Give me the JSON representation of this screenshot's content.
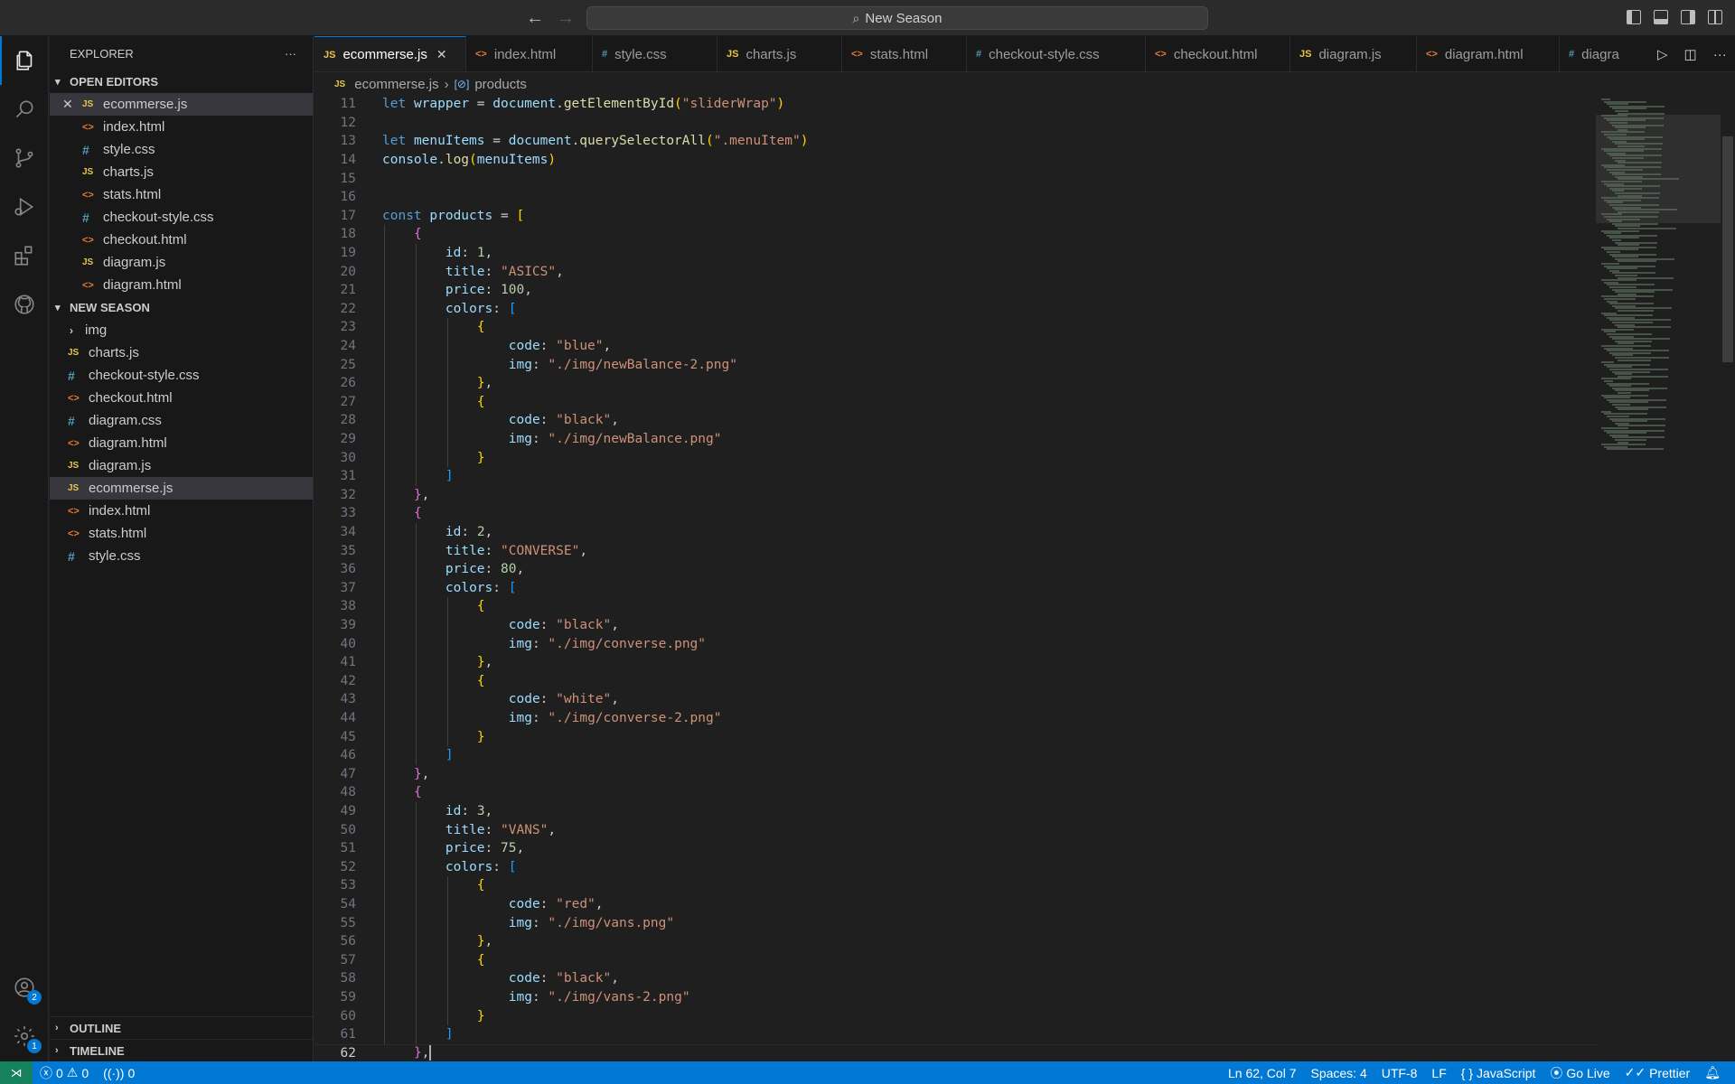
{
  "titlebar": {
    "search_text": "New Season"
  },
  "activity": {
    "accounts_badge": "2",
    "settings_badge": "1"
  },
  "explorer": {
    "title": "EXPLORER",
    "more": "···",
    "open_editors_title": "OPEN EDITORS",
    "open_editors": [
      {
        "name": "ecommerse.js",
        "type": "js"
      },
      {
        "name": "index.html",
        "type": "html"
      },
      {
        "name": "style.css",
        "type": "css"
      },
      {
        "name": "charts.js",
        "type": "js"
      },
      {
        "name": "stats.html",
        "type": "html"
      },
      {
        "name": "checkout-style.css",
        "type": "css"
      },
      {
        "name": "checkout.html",
        "type": "html"
      },
      {
        "name": "diagram.js",
        "type": "js"
      },
      {
        "name": "diagram.html",
        "type": "html"
      }
    ],
    "folder_title": "NEW SEASON",
    "folder_items": [
      {
        "name": "img",
        "type": "folder"
      },
      {
        "name": "charts.js",
        "type": "js"
      },
      {
        "name": "checkout-style.css",
        "type": "css"
      },
      {
        "name": "checkout.html",
        "type": "html"
      },
      {
        "name": "diagram.css",
        "type": "css"
      },
      {
        "name": "diagram.html",
        "type": "html"
      },
      {
        "name": "diagram.js",
        "type": "js"
      },
      {
        "name": "ecommerse.js",
        "type": "js"
      },
      {
        "name": "index.html",
        "type": "html"
      },
      {
        "name": "stats.html",
        "type": "html"
      },
      {
        "name": "style.css",
        "type": "css"
      }
    ],
    "outline_title": "OUTLINE",
    "timeline_title": "TIMELINE"
  },
  "tabs": [
    {
      "label": "ecommerse.js",
      "type": "js",
      "active": true
    },
    {
      "label": "index.html",
      "type": "html"
    },
    {
      "label": "style.css",
      "type": "css"
    },
    {
      "label": "charts.js",
      "type": "js"
    },
    {
      "label": "stats.html",
      "type": "html"
    },
    {
      "label": "checkout-style.css",
      "type": "css"
    },
    {
      "label": "checkout.html",
      "type": "html"
    },
    {
      "label": "diagram.js",
      "type": "js"
    },
    {
      "label": "diagram.html",
      "type": "html"
    },
    {
      "label": "diagra",
      "type": "css"
    }
  ],
  "breadcrumb": {
    "file": "ecommerse.js",
    "symbol": "products"
  },
  "code": [
    {
      "n": "11",
      "t": "let wrapper = document.getElementById(\"sliderWrap\")"
    },
    {
      "n": "12",
      "t": ""
    },
    {
      "n": "13",
      "t": "let menuItems = document.querySelectorAll(\".menuItem\")"
    },
    {
      "n": "14",
      "t": "console.log(menuItems)"
    },
    {
      "n": "15",
      "t": ""
    },
    {
      "n": "16",
      "t": ""
    },
    {
      "n": "17",
      "t": "const products = ["
    },
    {
      "n": "18",
      "t": "    {"
    },
    {
      "n": "19",
      "t": "        id: 1,"
    },
    {
      "n": "20",
      "t": "        title: \"ASICS\","
    },
    {
      "n": "21",
      "t": "        price: 100,"
    },
    {
      "n": "22",
      "t": "        colors: ["
    },
    {
      "n": "23",
      "t": "            {"
    },
    {
      "n": "24",
      "t": "                code: \"blue\","
    },
    {
      "n": "25",
      "t": "                img: \"./img/newBalance-2.png\""
    },
    {
      "n": "26",
      "t": "            },"
    },
    {
      "n": "27",
      "t": "            {"
    },
    {
      "n": "28",
      "t": "                code: \"black\","
    },
    {
      "n": "29",
      "t": "                img: \"./img/newBalance.png\""
    },
    {
      "n": "30",
      "t": "            }"
    },
    {
      "n": "31",
      "t": "        ]"
    },
    {
      "n": "32",
      "t": "    },"
    },
    {
      "n": "33",
      "t": "    {"
    },
    {
      "n": "34",
      "t": "        id: 2,"
    },
    {
      "n": "35",
      "t": "        title: \"CONVERSE\","
    },
    {
      "n": "36",
      "t": "        price: 80,"
    },
    {
      "n": "37",
      "t": "        colors: ["
    },
    {
      "n": "38",
      "t": "            {"
    },
    {
      "n": "39",
      "t": "                code: \"black\","
    },
    {
      "n": "40",
      "t": "                img: \"./img/converse.png\""
    },
    {
      "n": "41",
      "t": "            },"
    },
    {
      "n": "42",
      "t": "            {"
    },
    {
      "n": "43",
      "t": "                code: \"white\","
    },
    {
      "n": "44",
      "t": "                img: \"./img/converse-2.png\""
    },
    {
      "n": "45",
      "t": "            }"
    },
    {
      "n": "46",
      "t": "        ]"
    },
    {
      "n": "47",
      "t": "    },"
    },
    {
      "n": "48",
      "t": "    {"
    },
    {
      "n": "49",
      "t": "        id: 3,"
    },
    {
      "n": "50",
      "t": "        title: \"VANS\","
    },
    {
      "n": "51",
      "t": "        price: 75,"
    },
    {
      "n": "52",
      "t": "        colors: ["
    },
    {
      "n": "53",
      "t": "            {"
    },
    {
      "n": "54",
      "t": "                code: \"red\","
    },
    {
      "n": "55",
      "t": "                img: \"./img/vans.png\""
    },
    {
      "n": "56",
      "t": "            },"
    },
    {
      "n": "57",
      "t": "            {"
    },
    {
      "n": "58",
      "t": "                code: \"black\","
    },
    {
      "n": "59",
      "t": "                img: \"./img/vans-2.png\""
    },
    {
      "n": "60",
      "t": "            }"
    },
    {
      "n": "61",
      "t": "        ]"
    },
    {
      "n": "62",
      "t": "    },"
    }
  ],
  "current_line": "62",
  "status": {
    "errors": "0",
    "warnings": "0",
    "ports": "0",
    "position": "Ln 62, Col 7",
    "spaces": "Spaces: 4",
    "encoding": "UTF-8",
    "eol": "LF",
    "language": "JavaScript",
    "golive": "Go Live",
    "prettier": "Prettier"
  },
  "colors": {
    "accent": "#0078d4",
    "status_bg": "#0078d4",
    "remote_bg": "#16825d"
  }
}
